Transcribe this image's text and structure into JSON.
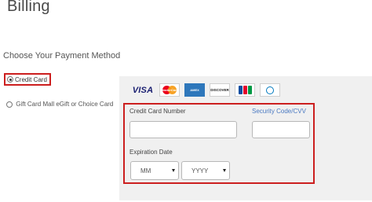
{
  "page": {
    "title": "Billing",
    "section_label": "Choose Your Payment Method"
  },
  "payment_methods": [
    {
      "label": "Credit Card",
      "selected": true
    },
    {
      "label": "Gift Card Mall eGift or Choice Card",
      "selected": false
    }
  ],
  "card_logos": [
    {
      "name": "visa-logo",
      "text": "VISA"
    },
    {
      "name": "mastercard-logo",
      "text": "MasterCard"
    },
    {
      "name": "amex-logo",
      "text": "AMEX"
    },
    {
      "name": "discover-logo",
      "text": "DISCOVER"
    },
    {
      "name": "jcb-logo",
      "text": "JCB"
    },
    {
      "name": "diners-club-logo",
      "text": "Diners Club"
    }
  ],
  "card_form": {
    "card_number_label": "Credit Card Number",
    "card_number_value": "",
    "security_code_label": "Security Code/CVV",
    "security_code_value": "",
    "expiration_label": "Expiration Date",
    "month_selected": "MM",
    "year_selected": "YYYY"
  },
  "colors": {
    "highlight_border": "#cc1f1f",
    "panel_background": "#f0f0f0",
    "link": "#4a79c2",
    "visa_blue": "#1a1f71",
    "amex_blue": "#2e77bb"
  }
}
